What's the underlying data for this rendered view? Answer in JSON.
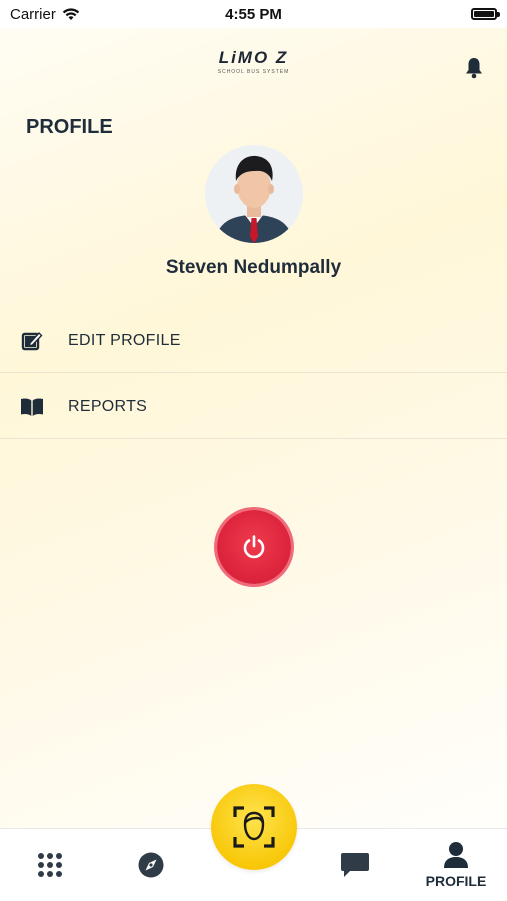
{
  "status_bar": {
    "carrier": "Carrier",
    "time": "4:55 PM"
  },
  "header": {
    "logo_text": "LiMO Z",
    "logo_tagline": "SCHOOL BUS SYSTEM"
  },
  "page_title": "PROFILE",
  "user": {
    "name": "Steven Nedumpally"
  },
  "menu": [
    {
      "label": "EDIT PROFILE",
      "icon": "edit-icon"
    },
    {
      "label": "REPORTS",
      "icon": "book-icon"
    }
  ],
  "tabs": [
    {
      "icon": "grid-icon",
      "label": ""
    },
    {
      "icon": "compass-icon",
      "label": ""
    },
    {
      "icon": "face-scan-icon",
      "label": ""
    },
    {
      "icon": "chat-icon",
      "label": ""
    },
    {
      "icon": "profile-icon",
      "label": "PROFILE"
    }
  ],
  "colors": {
    "accent_red": "#d9213a",
    "accent_yellow": "#f7c400",
    "text_dark": "#1f2d3a"
  }
}
